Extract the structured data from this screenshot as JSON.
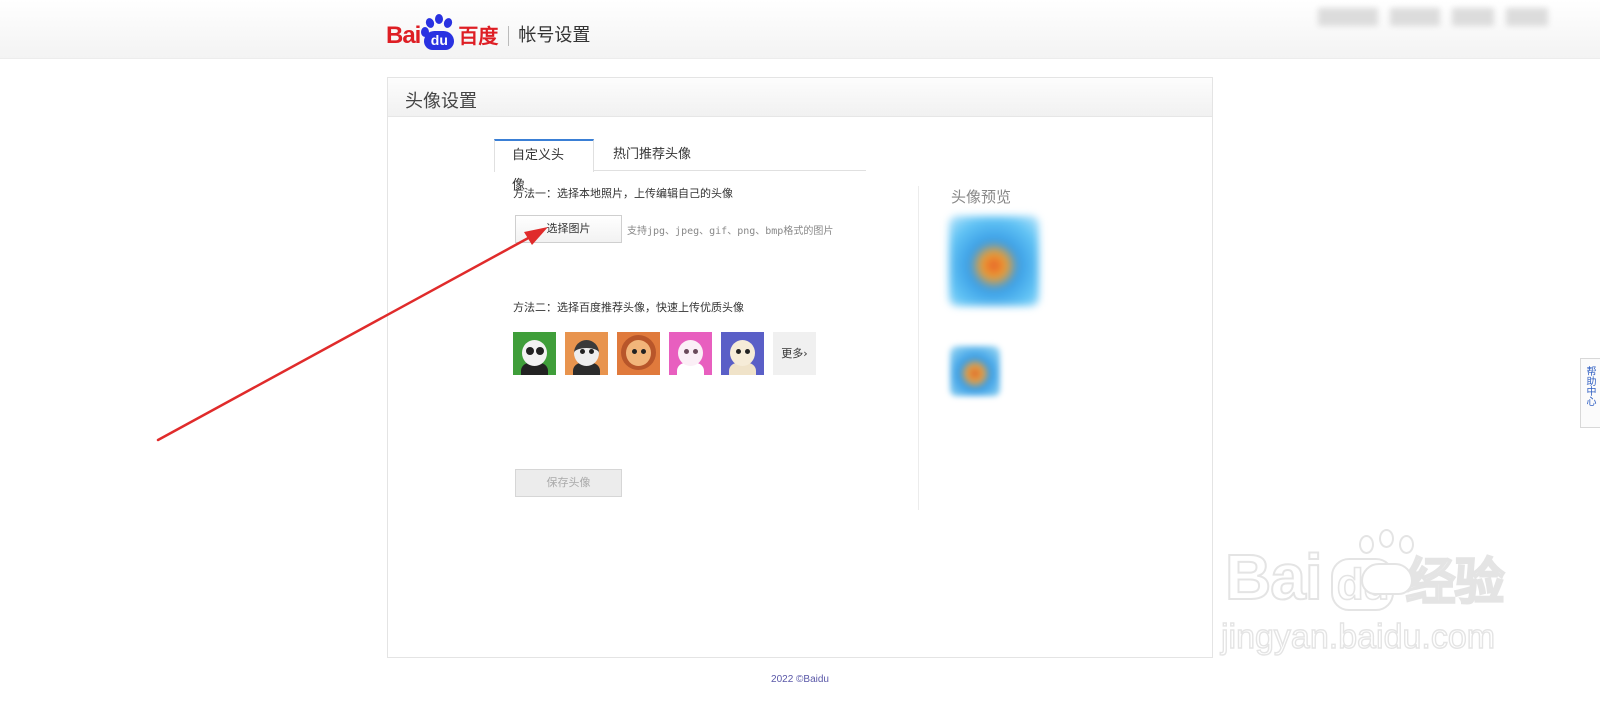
{
  "header": {
    "logo_latin": "Bai",
    "logo_paw_text": "du",
    "logo_cn": "百度",
    "section_title": "帐号设置"
  },
  "panel": {
    "title": "头像设置",
    "tabs": [
      {
        "label": "自定义头像",
        "active": true
      },
      {
        "label": "热门推荐头像",
        "active": false
      }
    ],
    "method_one": {
      "label": "方法一：选择本地照片，上传编辑自己的头像",
      "button": "选择图片",
      "hint": "支持jpg、jpeg、gif、png、bmp格式的图片"
    },
    "method_two": {
      "label": "方法二：选择百度推荐头像，快速上传优质头像",
      "avatars": [
        "panda-avatar",
        "husky-avatar",
        "lion-avatar",
        "cat-avatar",
        "cow-avatar"
      ],
      "more_label": "更多›"
    },
    "save_button": "保存头像",
    "preview_title": "头像预览"
  },
  "help_center": "帮助中心",
  "footer": {
    "copyright": "2022 ©Baidu"
  },
  "watermark": {
    "brand": "Bai",
    "brand_cn": "经验",
    "url": "jingyan.baidu.com"
  },
  "colors": {
    "baidu_red": "#de1e24",
    "baidu_blue": "#2932e1",
    "tab_accent": "#3a7fd5",
    "arrow": "#e02b2b"
  }
}
